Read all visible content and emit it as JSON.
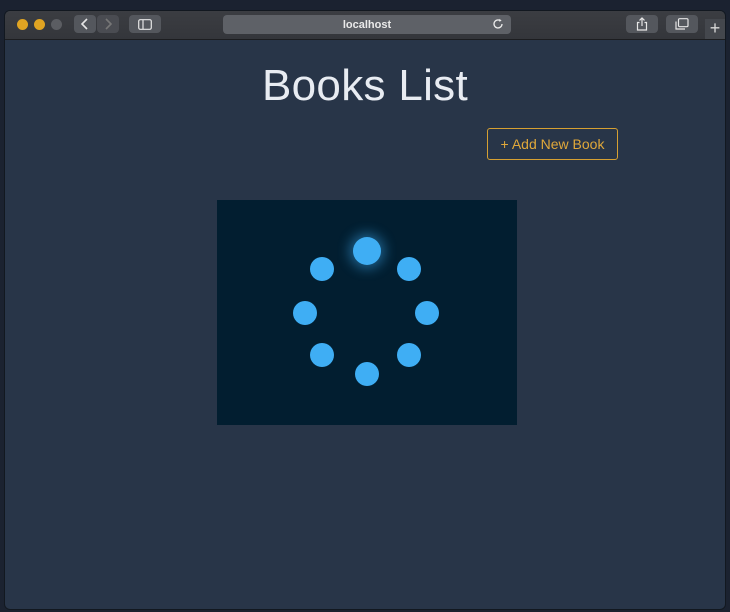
{
  "browser": {
    "address": "localhost",
    "icons": {
      "back": "chevron-left-icon",
      "forward": "chevron-right-icon",
      "sidebar": "sidebar-icon",
      "reload": "reload-icon",
      "share": "share-icon",
      "tabs": "tabs-icon",
      "new_tab": "plus-icon"
    },
    "new_tab_label": "+"
  },
  "page": {
    "title": "Books List",
    "add_button_label": "+ Add New Book"
  },
  "loader": {
    "dot_count": 8,
    "active_dot_index": 0,
    "dot_color": "#3faef4",
    "background_color": "#021e30"
  },
  "colors": {
    "page_background": "#283548",
    "accent": "#e0a83a"
  }
}
